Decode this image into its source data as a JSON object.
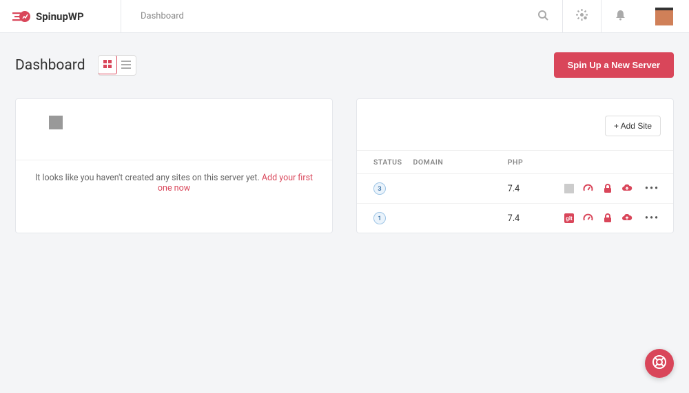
{
  "brand": {
    "name": "SpinupWP"
  },
  "breadcrumb": "Dashboard",
  "page_title": "Dashboard",
  "primary_button": "Spin Up a New Server",
  "add_site_button": "+ Add Site",
  "empty_server": {
    "message": "It looks like you haven't created any sites on this server yet. ",
    "link_text": "Add your first one now"
  },
  "sites_table": {
    "columns": {
      "status": "STATUS",
      "domain": "DOMAIN",
      "php": "PHP"
    },
    "rows": [
      {
        "status": "3",
        "domain": "",
        "php": "7.4",
        "git_muted": true
      },
      {
        "status": "1",
        "domain": "",
        "php": "7.4",
        "git_muted": false
      }
    ]
  },
  "colors": {
    "accent": "#d9465a",
    "status_badge_bg": "#eaf3fb",
    "status_badge_border": "#9ec5e6"
  }
}
